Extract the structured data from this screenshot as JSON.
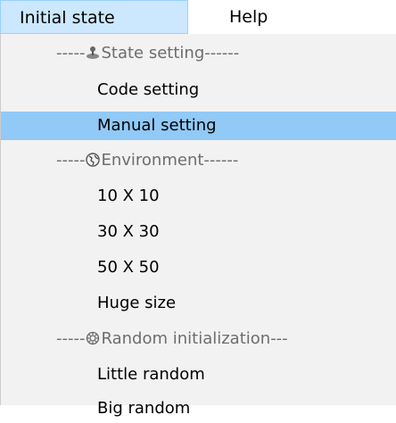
{
  "menubar": {
    "items": [
      {
        "label": "Initial state"
      },
      {
        "label": "Help"
      }
    ]
  },
  "menu": {
    "state_header": {
      "prefix": "-----",
      "label": "State setting------",
      "icon": "joystick-icon"
    },
    "code_setting": "Code setting",
    "manual_setting": "Manual setting",
    "env_header": {
      "prefix": "-----",
      "label": "Environment------",
      "icon": "globe-icon"
    },
    "size_10": "10 X 10",
    "size_30": "30 X 30",
    "size_50": "50 X 50",
    "size_huge": "Huge size",
    "random_header": {
      "prefix": "-----",
      "label": "Random initialization---",
      "icon": "gear-icon"
    },
    "little_random": "Little random",
    "big_random": "Big random"
  },
  "colors": {
    "menubar_active_bg": "#cce8ff",
    "menu_highlight_bg": "#91c9f7",
    "dropdown_bg": "#f2f2f2",
    "header_text": "#6d6d6d"
  }
}
